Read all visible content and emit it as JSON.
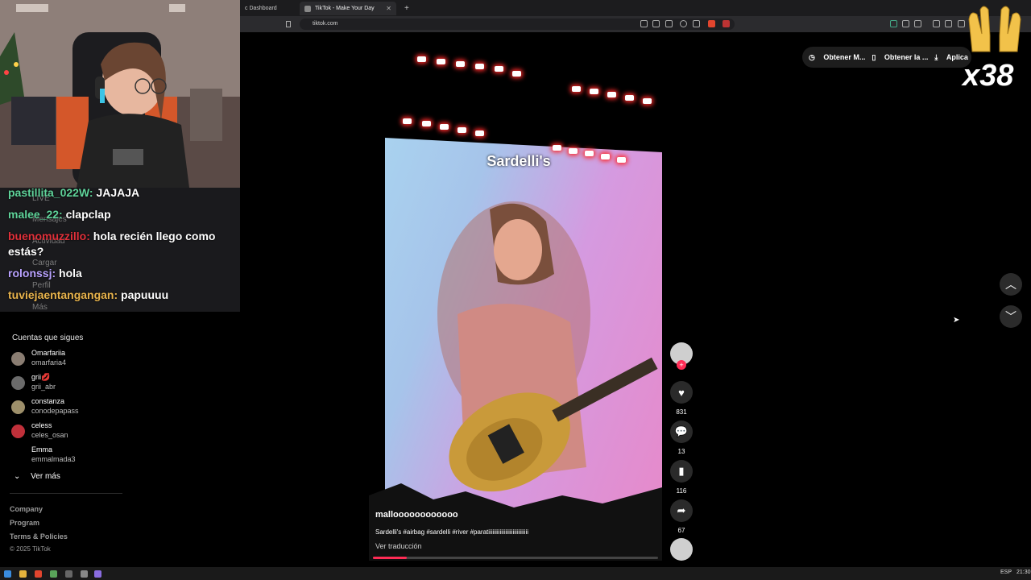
{
  "browser": {
    "tabs": [
      {
        "label": "c Dashboard",
        "active": false
      },
      {
        "label": "TikTok - Make Your Day",
        "active": true
      }
    ],
    "new_tab_icon": "plus-icon",
    "url": "tiktok.com"
  },
  "chat": {
    "messages": [
      {
        "user": "pastillita_022W:",
        "text": " JAJAJA",
        "color": "#5fd39a"
      },
      {
        "user": "malee_22:",
        "text": " clapclap",
        "color": "#5fd39a"
      },
      {
        "user": "buenomuzzillo:",
        "text": " hola  recién llego como estás?",
        "color": "#e0303a"
      },
      {
        "user": "rolonssj:",
        "text": " hola",
        "color": "#b9a2ff"
      },
      {
        "user": "tuviejaentangangan:",
        "text": " papuuuu",
        "color": "#e9b44c"
      }
    ],
    "ghost_nav": [
      "LIVE",
      "Mensajes",
      "Actividad",
      "Cargar",
      "Perfil",
      "Más"
    ]
  },
  "sidebar": {
    "following_title": "Cuentas que sigues",
    "following": [
      {
        "name": "Omarfariia",
        "handle": "omarfaria4"
      },
      {
        "name": "grii💋",
        "handle": "grii_abr"
      },
      {
        "name": "constanza",
        "handle": "conodepapass"
      },
      {
        "name": "celess",
        "handle": "celes_osan"
      },
      {
        "name": "Emma",
        "handle": "emmalmada3"
      }
    ],
    "see_more": "Ver más",
    "footer": [
      "Company",
      "Program",
      "Terms & Policies",
      "© 2025 TikTok"
    ]
  },
  "video": {
    "overlay_text": "Sardelli's",
    "username": "malloooooooooooo",
    "description": "Sardelli's #airbag #sardelli #river #paratiiiiiiiiiiiiiiiiiiiiiiiiiiii",
    "translate": "Ver traducción",
    "progress": 0.12
  },
  "actions": {
    "likes": "831",
    "comments": "13",
    "saves": "116",
    "shares": "67"
  },
  "top_buttons": [
    "Obtener M...",
    "Obtener la ...",
    "Aplica"
  ],
  "emote_text": "x38",
  "taskbar": {
    "lang": "ESP",
    "time": "21:30"
  },
  "colors": {
    "tiktok_red": "#fe2c55",
    "panel_dark": "#1a1a1d"
  }
}
